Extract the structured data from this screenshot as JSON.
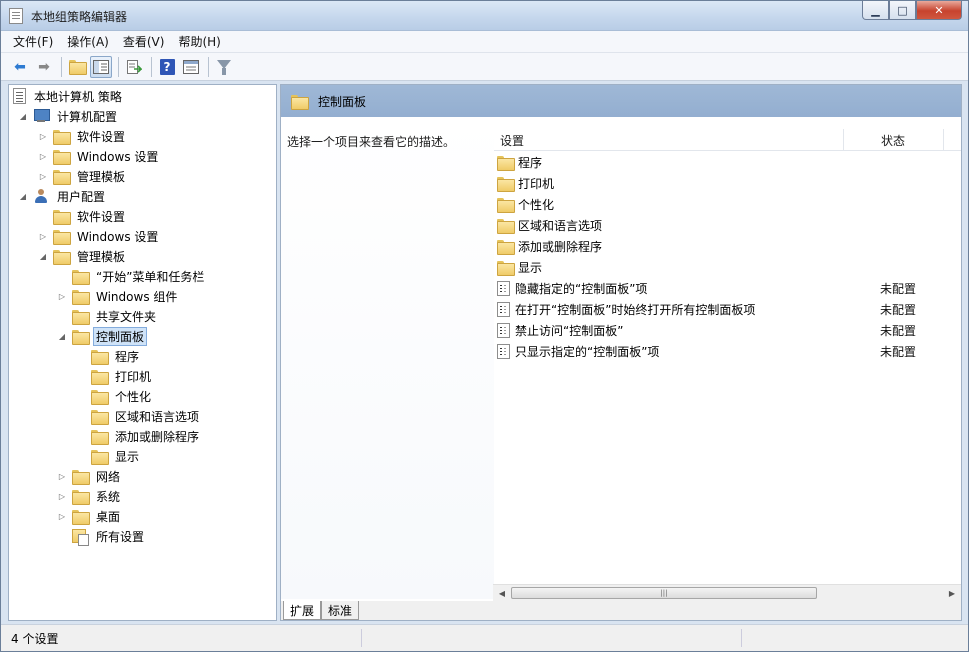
{
  "window": {
    "title": "本地组策略编辑器"
  },
  "menubar": {
    "items": [
      "文件(F)",
      "操作(A)",
      "查看(V)",
      "帮助(H)"
    ]
  },
  "toolbar": {
    "buttons": [
      "back-icon",
      "forward-icon",
      "up-folder-icon",
      "show-hide-tree-icon",
      "export-list-icon",
      "help-icon",
      "properties-icon",
      "filter-icon"
    ]
  },
  "tree": {
    "root": "本地计算机 策略",
    "computer_config": "计算机配置",
    "cc_software": "软件设置",
    "cc_windows": "Windows 设置",
    "cc_admin": "管理模板",
    "user_config": "用户配置",
    "uc_software": "软件设置",
    "uc_windows": "Windows 设置",
    "uc_admin": "管理模板",
    "start_menu": "“开始”菜单和任务栏",
    "win_components": "Windows 组件",
    "shared_folders": "共享文件夹",
    "control_panel": "控制面板",
    "cp_programs": "程序",
    "cp_printers": "打印机",
    "cp_personalization": "个性化",
    "cp_region": "区域和语言选项",
    "cp_addremove": "添加或删除程序",
    "cp_display": "显示",
    "network": "网络",
    "system": "系统",
    "desktop": "桌面",
    "all_settings": "所有设置"
  },
  "right": {
    "header": "控制面板",
    "description": "选择一个项目来查看它的描述。",
    "columns": {
      "setting": "设置",
      "state": "状态"
    },
    "folders": [
      "程序",
      "打印机",
      "个性化",
      "区域和语言选项",
      "添加或删除程序",
      "显示"
    ],
    "settings": [
      {
        "name": "隐藏指定的“控制面板”项",
        "state": "未配置"
      },
      {
        "name": "在打开“控制面板”时始终打开所有控制面板项",
        "state": "未配置"
      },
      {
        "name": "禁止访问“控制面板”",
        "state": "未配置"
      },
      {
        "name": "只显示指定的“控制面板”项",
        "state": "未配置"
      }
    ],
    "tabs": {
      "extended": "扩展",
      "standard": "标准"
    }
  },
  "statusbar": {
    "text": "4 个设置"
  }
}
